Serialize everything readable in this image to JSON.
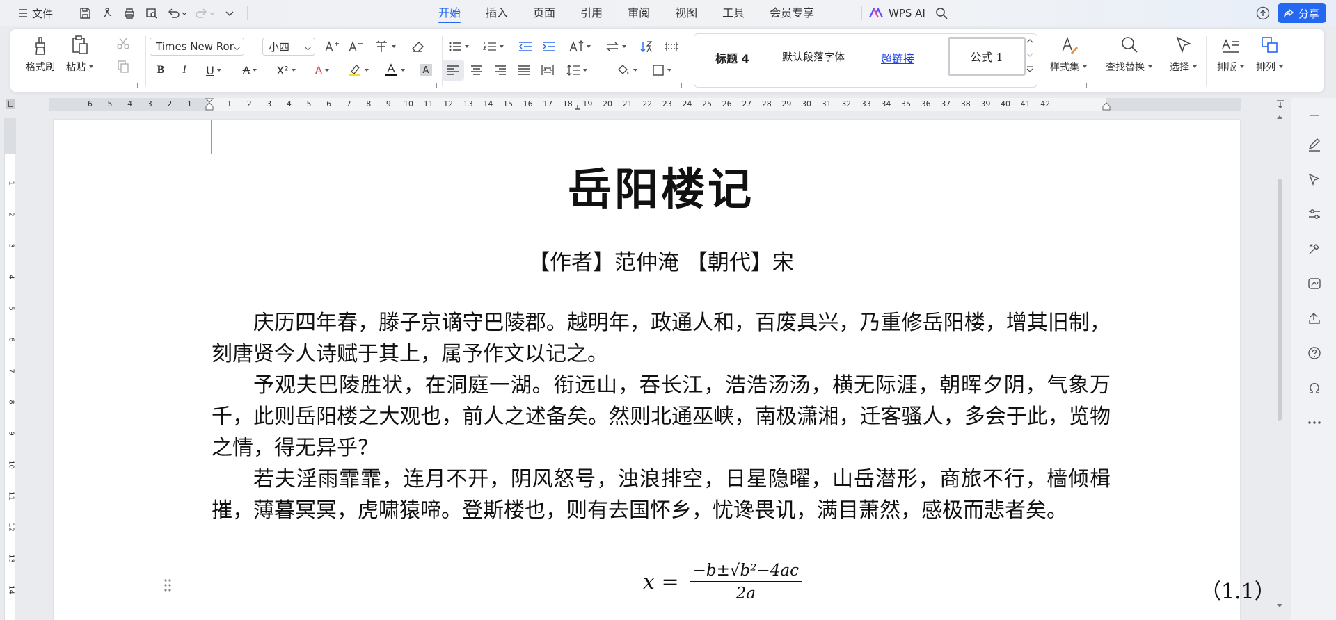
{
  "menubar": {
    "file_label": "文件",
    "tabs": [
      {
        "label": "开始",
        "active": true
      },
      {
        "label": "插入",
        "active": false
      },
      {
        "label": "页面",
        "active": false
      },
      {
        "label": "引用",
        "active": false
      },
      {
        "label": "审阅",
        "active": false
      },
      {
        "label": "视图",
        "active": false
      },
      {
        "label": "工具",
        "active": false
      },
      {
        "label": "会员专享",
        "active": false
      }
    ],
    "wps_ai_label": "WPS AI",
    "share_label": "分享"
  },
  "ribbon": {
    "format_painter": "格式刷",
    "paste": "粘贴",
    "font_name": "Times New Roman",
    "font_size": "小四",
    "style_gallery": {
      "heading4": "标题  4",
      "default_font": "默认段落字体",
      "hyperlink": "超链接",
      "formula": "公式 1"
    },
    "styles": "样式集",
    "find_replace": "查找替换",
    "select": "选择",
    "layout": "排版",
    "arrange": "排列"
  },
  "ruler": {
    "left_numbers": [
      "6",
      "5",
      "4",
      "3",
      "2",
      "1"
    ],
    "right_numbers": [
      "1",
      "2",
      "3",
      "4",
      "5",
      "6",
      "7",
      "8",
      "9",
      "10",
      "11",
      "12",
      "13",
      "14",
      "15",
      "16",
      "17",
      "18",
      "19",
      "20",
      "21",
      "22",
      "23",
      "24",
      "25",
      "26",
      "27",
      "28",
      "29",
      "30",
      "31",
      "32",
      "33",
      "34",
      "35",
      "36",
      "37",
      "38",
      "39",
      "40",
      "41",
      "42"
    ],
    "vertical_numbers": [
      "1",
      "2",
      "3",
      "4",
      "5",
      "6",
      "7",
      "8",
      "9",
      "10",
      "11",
      "12",
      "13",
      "14"
    ]
  },
  "document": {
    "title": "岳阳楼记",
    "author_line": "【作者】范仲淹  【朝代】宋",
    "paragraphs": [
      "庆历四年春，滕子京谪守巴陵郡。越明年，政通人和，百废具兴，乃重修岳阳楼，增其旧制，刻唐贤今人诗赋于其上，属予作文以记之。",
      "予观夫巴陵胜状，在洞庭一湖。衔远山，吞长江，浩浩汤汤，横无际涯，朝晖夕阴，气象万千，此则岳阳楼之大观也，前人之述备矣。然则北通巫峡，南极潇湘，迁客骚人，多会于此，览物之情，得无异乎？",
      "若夫淫雨霏霏，连月不开，阴风怒号，浊浪排空，日星隐曜，山岳潜形，商旅不行，樯倾楫摧，薄暮冥冥，虎啸猿啼。登斯楼也，则有去国怀乡，忧谗畏讥，满目萧然，感极而悲者矣。"
    ],
    "formula": {
      "lhs": "x =",
      "numerator": "−b±√b²−4ac",
      "denominator": "2a",
      "number": "（1.1）"
    }
  },
  "colors": {
    "accent": "#2468f2",
    "hyperlink": "#1a3fe0"
  }
}
